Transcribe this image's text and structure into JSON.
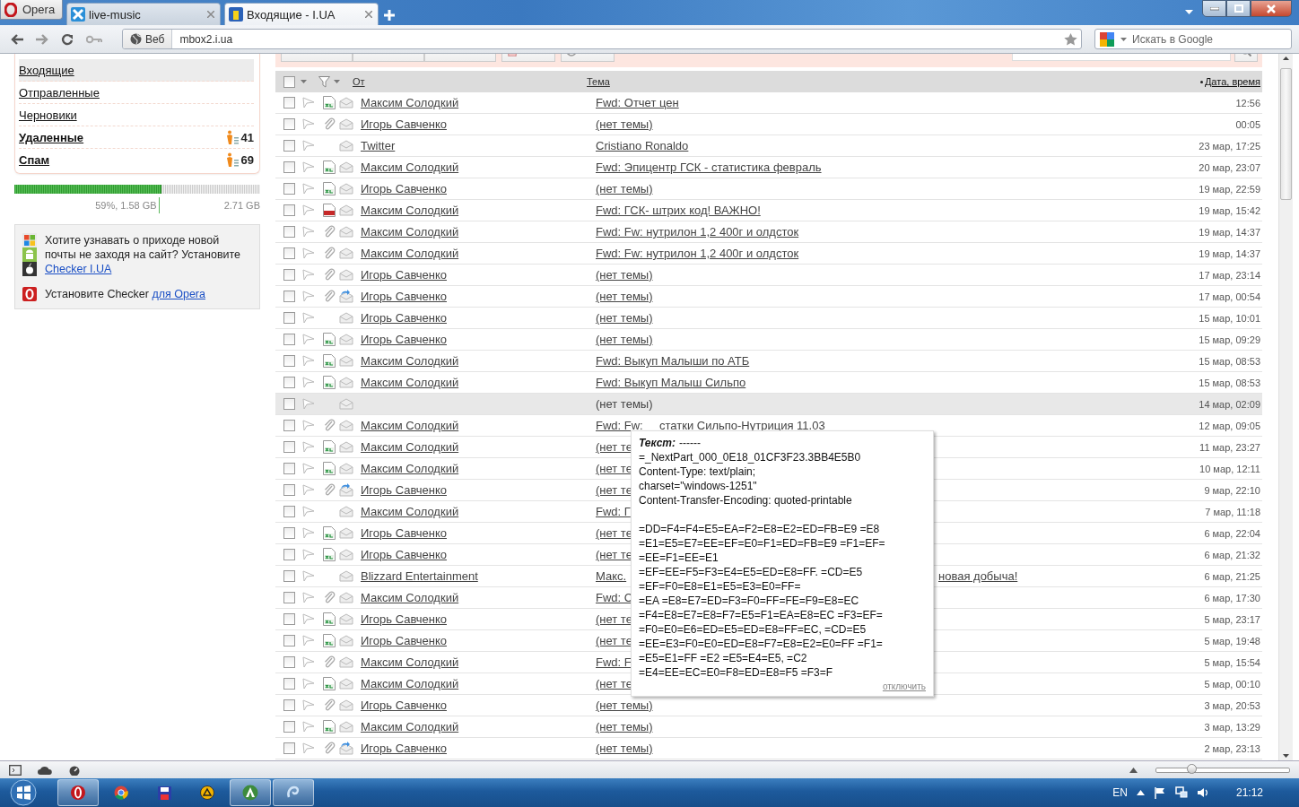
{
  "browser": {
    "opera_button": "Opera",
    "tabs": [
      {
        "title": "live-music",
        "selected": false
      },
      {
        "title": "Входящие - I.UA",
        "selected": true
      }
    ],
    "web_badge": "Веб",
    "url": "mbox2.i.ua",
    "search_placeholder": "Искать в Google"
  },
  "toolbar": {
    "buttons": [
      {
        "kind": "dropdown"
      },
      {
        "kind": "dropdown"
      },
      {
        "kind": "dropdown"
      },
      {
        "kind": "delete"
      },
      {
        "kind": "spam"
      }
    ]
  },
  "sidebar": {
    "folders": [
      {
        "name": "Входящие",
        "selected": true,
        "bold": false
      },
      {
        "name": "Отправленные",
        "selected": false,
        "bold": false
      },
      {
        "name": "Черновики",
        "selected": false,
        "bold": false
      },
      {
        "name": "Удаленные",
        "selected": false,
        "bold": true,
        "count": "41"
      },
      {
        "name": "Спам",
        "selected": false,
        "bold": true,
        "count": "69"
      }
    ],
    "storage": {
      "level": 0.59,
      "used": "59%, 1.58 GB",
      "total": "2.71 GB"
    },
    "promo": {
      "text": "Хотите узнавать о приходе новой почты не заходя на сайт? Установите",
      "link": "Checker I.UA",
      "opera_text": "Установите Checker",
      "opera_link": "для Opera"
    }
  },
  "list": {
    "select_all": {
      "checked": false
    },
    "columns": {
      "from": "От",
      "subject": "Тема",
      "date": "Дата, время"
    },
    "rows": [
      {
        "sender": "Максим Солодкий",
        "subject": "Fwd: Отчет цен",
        "date": "12:56",
        "attachment": {
          "kind": "xls"
        },
        "envelope": {
          "kind": "read"
        },
        "checked": false,
        "flagged": false,
        "highlighted": false
      },
      {
        "sender": "Игорь Савченко",
        "subject": "(нет темы)",
        "date": "00:05",
        "attachment": {
          "kind": "clip"
        },
        "envelope": {
          "kind": "read"
        },
        "checked": false,
        "flagged": false,
        "highlighted": false
      },
      {
        "sender": "Twitter",
        "subject": "Cristiano Ronaldo",
        "date": "23 мар, 17:25",
        "envelope": {
          "kind": "read"
        },
        "checked": false,
        "flagged": false,
        "highlighted": false
      },
      {
        "sender": "Максим Солодкий",
        "subject": "Fwd: Эпицентр ГСК - статистика февраль",
        "date": "20 мар, 23:07",
        "attachment": {
          "kind": "xls"
        },
        "envelope": {
          "kind": "read"
        },
        "checked": false,
        "flagged": false,
        "highlighted": false
      },
      {
        "sender": "Игорь Савченко",
        "subject": "(нет темы)",
        "date": "19 мар, 22:59",
        "attachment": {
          "kind": "xls"
        },
        "envelope": {
          "kind": "read"
        },
        "checked": false,
        "flagged": false,
        "highlighted": false
      },
      {
        "sender": "Максим Солодкий",
        "subject": "Fwd: ГСК- штрих код! ВАЖНО!",
        "date": "19 мар, 15:42",
        "attachment": {
          "kind": "pdf"
        },
        "envelope": {
          "kind": "read"
        },
        "checked": false,
        "flagged": false,
        "highlighted": false
      },
      {
        "sender": "Максим Солодкий",
        "subject": "Fwd: Fw: нутрилон 1,2 400г и олдсток",
        "date": "19 мар, 14:37",
        "attachment": {
          "kind": "clip"
        },
        "envelope": {
          "kind": "read"
        },
        "checked": false,
        "flagged": false,
        "highlighted": false
      },
      {
        "sender": "Максим Солодкий",
        "subject": "Fwd: Fw: нутрилон 1,2 400г и олдсток",
        "date": "19 мар, 14:37",
        "attachment": {
          "kind": "clip"
        },
        "envelope": {
          "kind": "read"
        },
        "checked": false,
        "flagged": false,
        "highlighted": false
      },
      {
        "sender": "Игорь Савченко",
        "subject": "(нет темы)",
        "date": "17 мар, 23:14",
        "attachment": {
          "kind": "clip"
        },
        "envelope": {
          "kind": "read"
        },
        "checked": false,
        "flagged": false,
        "highlighted": false
      },
      {
        "sender": "Игорь Савченко",
        "subject": "(нет темы)",
        "date": "17 мар, 00:54",
        "attachment": {
          "kind": "clip"
        },
        "envelope": {
          "kind": "replied"
        },
        "checked": false,
        "flagged": false,
        "highlighted": false
      },
      {
        "sender": "Игорь Савченко",
        "subject": "(нет темы)",
        "date": "15 мар, 10:01",
        "envelope": {
          "kind": "read"
        },
        "checked": false,
        "flagged": false,
        "highlighted": false
      },
      {
        "sender": "Игорь Савченко",
        "subject": "(нет темы)",
        "date": "15 мар, 09:29",
        "attachment": {
          "kind": "xls"
        },
        "envelope": {
          "kind": "read"
        },
        "checked": false,
        "flagged": false,
        "highlighted": false
      },
      {
        "sender": "Максим Солодкий",
        "subject": "Fwd: Выкуп Малыши по АТБ",
        "date": "15 мар, 08:53",
        "attachment": {
          "kind": "xls"
        },
        "envelope": {
          "kind": "read"
        },
        "checked": false,
        "flagged": false,
        "highlighted": false
      },
      {
        "sender": "Максим Солодкий",
        "subject": "Fwd: Выкуп Малыш Сильпо",
        "date": "15 мар, 08:53",
        "attachment": {
          "kind": "xls"
        },
        "envelope": {
          "kind": "read"
        },
        "checked": false,
        "flagged": false,
        "highlighted": false
      },
      {
        "subject": "(нет темы)",
        "date": "14 мар, 02:09",
        "envelope": {
          "kind": "read"
        },
        "checked": false,
        "flagged": false,
        "highlighted": true
      },
      {
        "sender": "Максим Солодкий",
        "subject": "Fwd: Fw:",
        "subject_tail": "статки Сильпо-Нутриция 11.03",
        "date": "12 мар, 09:05",
        "attachment": {
          "kind": "clip"
        },
        "envelope": {
          "kind": "read"
        },
        "checked": false,
        "flagged": false,
        "highlighted": false
      },
      {
        "sender": "Максим Солодкий",
        "subject": "(нет те",
        "date": "11 мар, 23:27",
        "attachment": {
          "kind": "xls"
        },
        "envelope": {
          "kind": "read"
        },
        "checked": false,
        "flagged": false,
        "highlighted": false
      },
      {
        "sender": "Максим Солодкий",
        "subject": "(нет те",
        "date": "10 мар, 12:11",
        "attachment": {
          "kind": "xls"
        },
        "envelope": {
          "kind": "read"
        },
        "checked": false,
        "flagged": false,
        "highlighted": false
      },
      {
        "sender": "Игорь Савченко",
        "subject": "(нет те",
        "date": "9 мар, 22:10",
        "attachment": {
          "kind": "clip"
        },
        "envelope": {
          "kind": "replied"
        },
        "checked": false,
        "flagged": false,
        "highlighted": false
      },
      {
        "sender": "Максим Солодкий",
        "subject": "Fwd: Г",
        "date": "7 мар, 11:18",
        "envelope": {
          "kind": "read"
        },
        "checked": false,
        "flagged": false,
        "highlighted": false
      },
      {
        "sender": "Игорь Савченко",
        "subject": "(нет те",
        "date": "6 мар, 22:04",
        "attachment": {
          "kind": "xls"
        },
        "envelope": {
          "kind": "read"
        },
        "checked": false,
        "flagged": false,
        "highlighted": false
      },
      {
        "sender": "Игорь Савченко",
        "subject": "(нет те",
        "date": "6 мар, 21:32",
        "attachment": {
          "kind": "xls"
        },
        "envelope": {
          "kind": "read"
        },
        "checked": false,
        "flagged": false,
        "highlighted": false
      },
      {
        "sender": "Blizzard Entertainment",
        "subject": "Макс.",
        "subject_tail": "новая добыча!",
        "date": "6 мар, 21:25",
        "envelope": {
          "kind": "read"
        },
        "checked": false,
        "flagged": false,
        "highlighted": false
      },
      {
        "sender": "Максим Солодкий",
        "subject": "Fwd: С",
        "date": "6 мар, 17:30",
        "attachment": {
          "kind": "clip"
        },
        "envelope": {
          "kind": "read"
        },
        "checked": false,
        "flagged": false,
        "highlighted": false
      },
      {
        "sender": "Игорь Савченко",
        "subject": "(нет те",
        "date": "5 мар, 23:17",
        "attachment": {
          "kind": "xls"
        },
        "envelope": {
          "kind": "read"
        },
        "checked": false,
        "flagged": false,
        "highlighted": false
      },
      {
        "sender": "Игорь Савченко",
        "subject": "(нет те",
        "date": "5 мар, 19:48",
        "attachment": {
          "kind": "xls"
        },
        "envelope": {
          "kind": "read"
        },
        "checked": false,
        "flagged": false,
        "highlighted": false
      },
      {
        "sender": "Максим Солодкий",
        "subject": "Fwd: F",
        "date": "5 мар, 15:54",
        "attachment": {
          "kind": "clip"
        },
        "envelope": {
          "kind": "read"
        },
        "checked": false,
        "flagged": false,
        "highlighted": false
      },
      {
        "sender": "Максим Солодкий",
        "subject": "(нет те",
        "date": "5 мар, 00:10",
        "attachment": {
          "kind": "xls"
        },
        "envelope": {
          "kind": "read"
        },
        "checked": false,
        "flagged": false,
        "highlighted": false
      },
      {
        "sender": "Игорь Савченко",
        "subject": "(нет темы)",
        "date": "3 мар, 20:53",
        "attachment": {
          "kind": "clip"
        },
        "envelope": {
          "kind": "read"
        },
        "checked": false,
        "flagged": false,
        "highlighted": false
      },
      {
        "sender": "Максим Солодкий",
        "subject": "(нет темы)",
        "date": "3 мар, 13:29",
        "attachment": {
          "kind": "xls"
        },
        "envelope": {
          "kind": "read"
        },
        "checked": false,
        "flagged": false,
        "highlighted": false
      },
      {
        "sender": "Игорь Савченко",
        "subject": "(нет темы)",
        "date": "2 мар, 23:13",
        "attachment": {
          "kind": "clip"
        },
        "envelope": {
          "kind": "replied"
        },
        "checked": false,
        "flagged": false,
        "highlighted": false
      }
    ]
  },
  "tooltip": {
    "label": "Текст:",
    "value": "------",
    "header_lines": [
      "=_NextPart_000_0E18_01CF3F23.3BB4E5B0",
      "Content-Type: text/plain;",
      "charset=\"windows-1251\"",
      "Content-Transfer-Encoding: quoted-printable"
    ],
    "body_lines": [
      "=DD=F4=F4=E5=EA=F2=E8=E2=ED=FB=E9 =E8",
      "=E1=E5=E7=EE=EF=E0=F1=ED=FB=E9 =F1=EF=",
      "=EE=F1=EE=E1",
      "=EF=EE=F5=F3=E4=E5=ED=E8=FF. =CD=E5",
      "=EF=F0=E8=E1=E5=E3=E0=FF=",
      "=EA =E8=E7=ED=F3=F0=FF=FE=F9=E8=EC",
      "=F4=E8=E7=E8=F7=E5=F1=EA=E8=EC =F3=EF=",
      "=F0=E0=E6=ED=E5=ED=E8=FF=EC, =CD=E5",
      "=EE=E3=F0=E0=ED=E8=F7=E8=E2=E0=FF =F1=",
      "=E5=E1=FF =E2 =E5=E4=E5, =C2",
      "=E4=EE=EC=E0=F8=ED=E8=F5 =F3=F"
    ],
    "link": "отключить"
  },
  "status_bar": {
    "zoom": {
      "level": 0.27
    }
  },
  "taskbar": {
    "language": "EN",
    "clock": "21:12"
  }
}
